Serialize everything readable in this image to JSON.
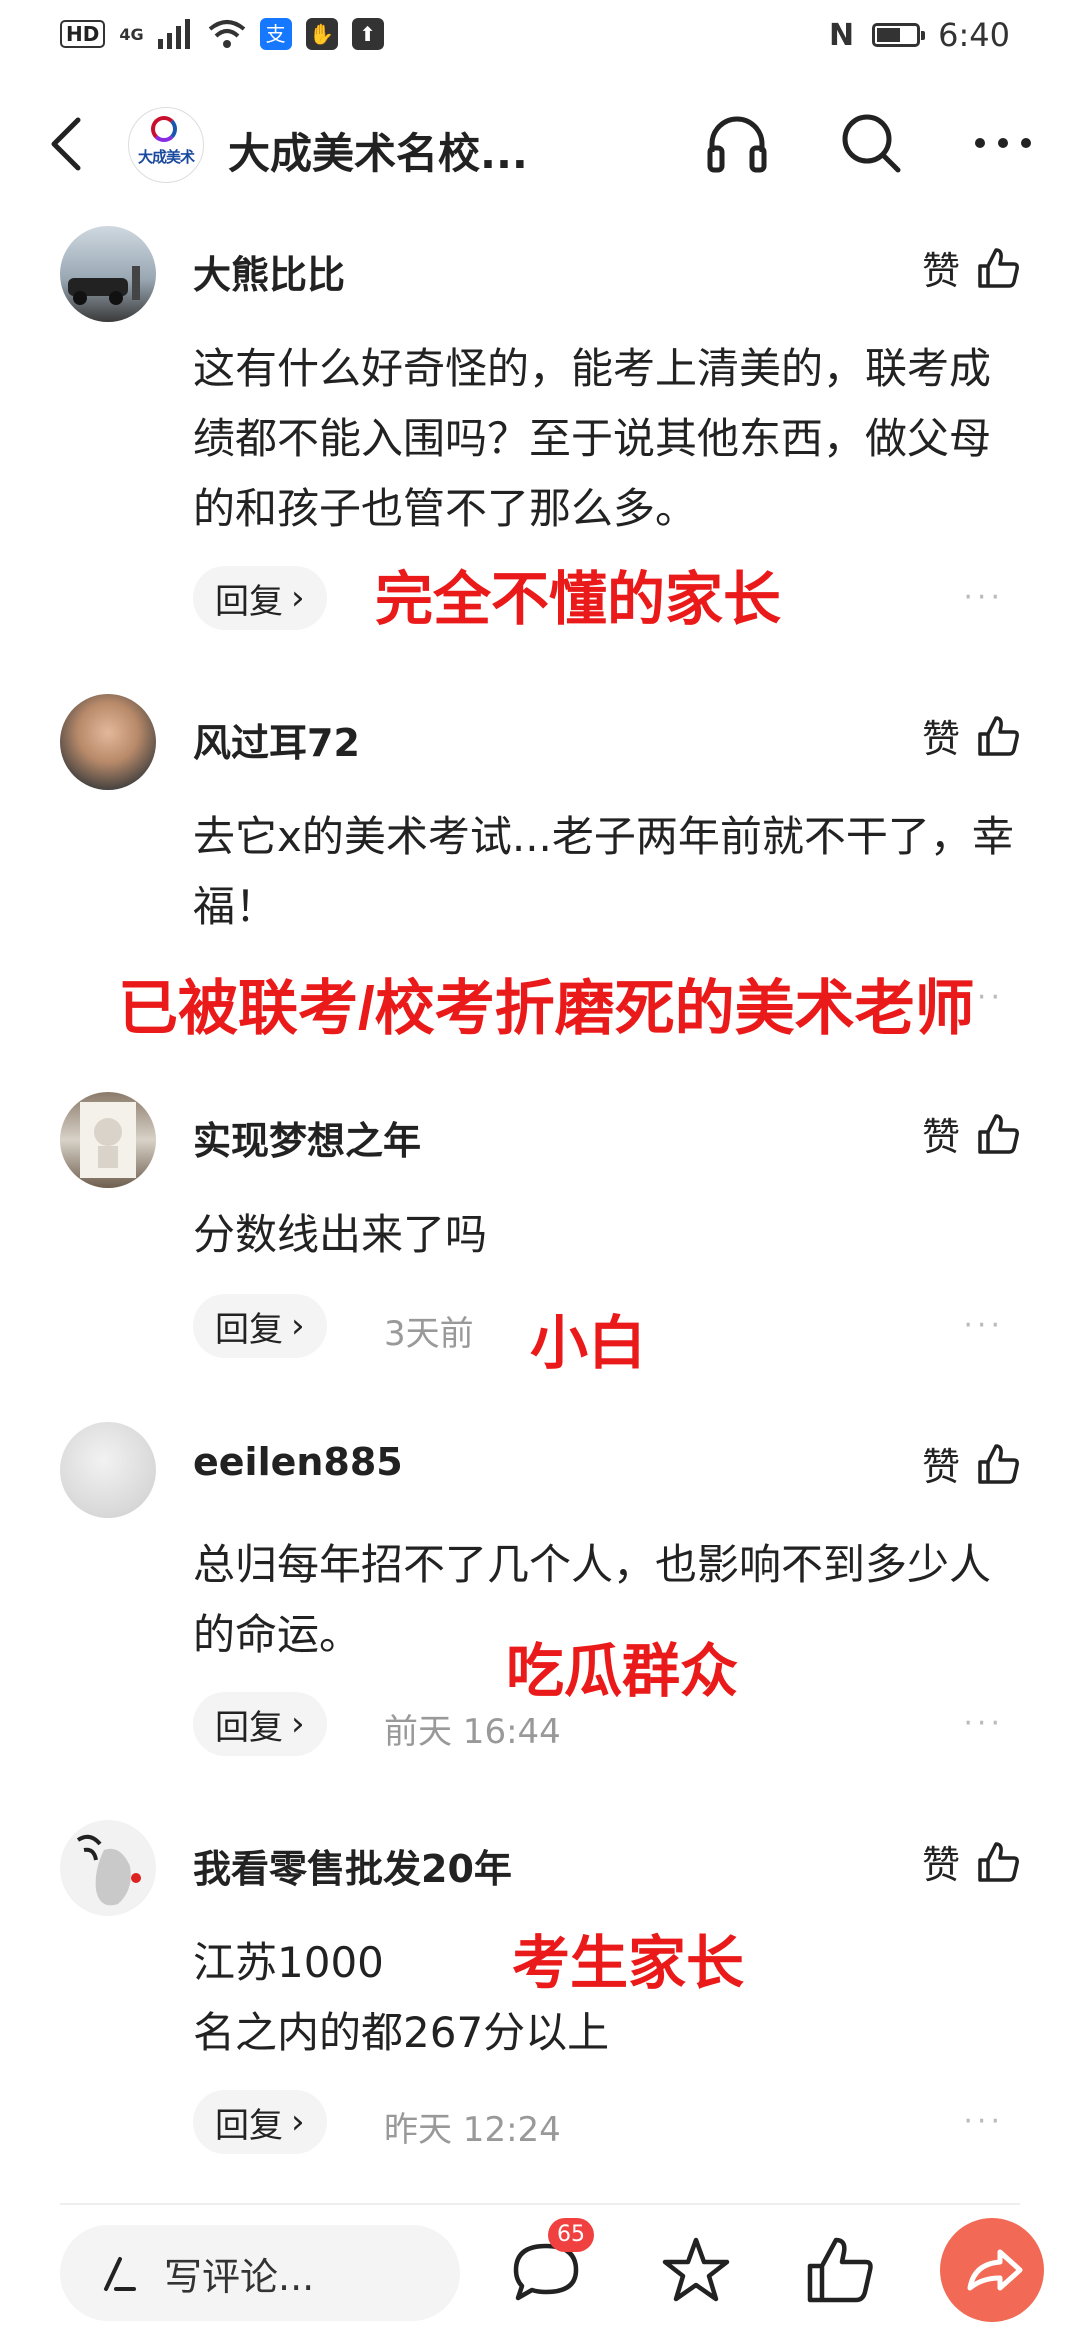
{
  "status_bar": {
    "hd": "HD",
    "network": "4G",
    "time": "6:40",
    "battery_level": 0.6
  },
  "header": {
    "logo_text": "大成美术",
    "title": "大成美术名校..."
  },
  "comments": [
    {
      "username": "大熊比比",
      "text": "这有什么好奇怪的，能考上清美的，联考成绩都不能入围吗？至于说其他东西，做父母的和孩子也管不了那么多。",
      "like_label": "赞",
      "reply_label": "回复",
      "time": "",
      "annotation": "完全不懂的家长"
    },
    {
      "username": "风过耳72",
      "text": "去它x的美术考试...老子两年前就不干了，幸福！",
      "like_label": "赞",
      "reply_label": "",
      "time": "",
      "annotation": "已被联考/校考折磨死的美术老师"
    },
    {
      "username": "实现梦想之年",
      "text": "分数线出来了吗",
      "like_label": "赞",
      "reply_label": "回复",
      "time": "3天前",
      "annotation": "小白"
    },
    {
      "username": "eeilen885",
      "text": "总归每年招不了几个人，也影响不到多少人的命运。",
      "like_label": "赞",
      "reply_label": "回复",
      "time": "前天  16:44",
      "annotation": "吃瓜群众"
    },
    {
      "username": "我看零售批发20年",
      "text_line1": "江苏1000",
      "text_line2": "名之内的都267分以上",
      "like_label": "赞",
      "reply_label": "回复",
      "time": "昨天  12:24",
      "annotation": "考生家长"
    }
  ],
  "bottom_bar": {
    "input_placeholder": "写评论...",
    "comment_count": "65"
  },
  "colors": {
    "annotation": "#ea1a1a",
    "badge": "#f04040",
    "share": "#f26a55"
  }
}
